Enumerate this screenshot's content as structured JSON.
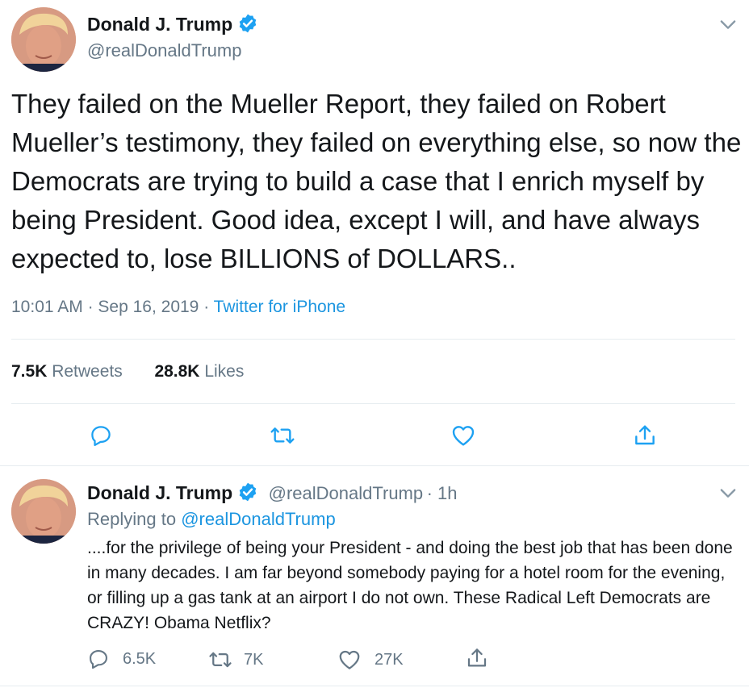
{
  "main_tweet": {
    "author_name": "Donald J. Trump",
    "author_handle": "@realDonaldTrump",
    "text": "They failed on the Mueller Report, they failed on Robert Mueller’s testimony, they failed on everything else, so now the Democrats are trying to build a case that I enrich myself by being President. Good idea, except I will, and have always expected to, lose BILLIONS of DOLLARS..",
    "time": "10:01 AM",
    "date": "Sep 16, 2019",
    "source": "Twitter for iPhone",
    "retweets_count": "7.5K",
    "retweets_label": "Retweets",
    "likes_count": "28.8K",
    "likes_label": "Likes"
  },
  "reply_tweet": {
    "author_name": "Donald J. Trump",
    "author_handle": "@realDonaldTrump",
    "age": "1h",
    "replying_prefix": "Replying to",
    "replying_to": "@realDonaldTrump",
    "text": "....for the privilege of being your President - and doing the best job that has been done in many decades. I am far beyond somebody paying for a hotel room for the evening, or filling up a gas tank at an airport I do not own. These Radical Left Democrats are CRAZY! Obama Netflix?",
    "reply_count": "6.5K",
    "retweet_count": "7K",
    "like_count": "27K"
  },
  "colors": {
    "verified": "#1da1f2",
    "link": "#1b95e0",
    "icon": "#657786",
    "action_icon_main": "#1da1f2"
  }
}
